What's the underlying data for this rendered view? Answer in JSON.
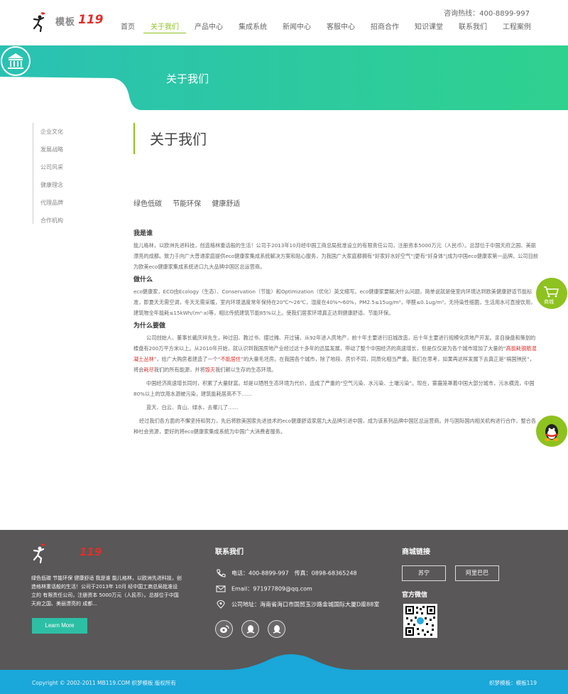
{
  "header": {
    "brand_text": "模板",
    "brand_num": "119",
    "hotline": "咨询热线：400-8899-997",
    "nav": [
      {
        "label": "首页",
        "active": false
      },
      {
        "label": "关于我们",
        "active": true
      },
      {
        "label": "产品中心",
        "active": false
      },
      {
        "label": "集成系统",
        "active": false
      },
      {
        "label": "新闻中心",
        "active": false
      },
      {
        "label": "客服中心",
        "active": false
      },
      {
        "label": "招商合作",
        "active": false
      },
      {
        "label": "知识课堂",
        "active": false
      },
      {
        "label": "联系我们",
        "active": false
      },
      {
        "label": "工程案例",
        "active": false
      }
    ]
  },
  "banner": {
    "title": "关于我们",
    "icon": "bank-icon"
  },
  "sidebar": {
    "items": [
      "企业文化",
      "发展战略",
      "公司风采",
      "健康理念",
      "代理品牌",
      "合作机构"
    ]
  },
  "main": {
    "title": "关于我们",
    "tags": [
      "绿色低碳",
      "节能环保",
      "健康舒适"
    ],
    "sections": {
      "who_title": "我是谁",
      "who_text": "能儿格林，以欧洲先进科技，创造格林重话般的生活！公司于2013年10月经中国工商总局批准设立的有限责任公司，注册资本5000万元（人民币）。总部位于中国天府之国、美丽漂亮的成都。致力于向广大普通家庭提供eco健康家集成系统解决方案和贴心服务，为我国广大家庭都拥有“好家好水好空气”|更有“好身体”|成为中国eco健康家第一品牌。公司目前为欧美eco健康家集成系统进口九大品牌中国区总运营商。",
      "what_title": "做什么",
      "what_text": "eco健康家，ECO由Ecology（生态）、Conservation（节能）和Optimization（优化）英文缩写。eco健康家要解决什么问题，简单说就是使室内环境达到欧美健康舒适节能标准，即夏天无需空调，冬天无需采暖，室内环境温度常年保持在20℃～26℃，湿度在40%～60%，PM2.5≤15ug/m³，甲醛≤0.1ug/m³，无持染性细菌，生活用水可直接饮用，建筑物全年能耗≤15kWh/(m²·a)等，相比传统建筑节能85%以上。使我们居家环境真正达到健康舒适、节能环保。",
      "why_title": "为什么要做",
      "why_p1_a": "公司创始人、董事长戴庆祥先生，种过田、教过书、摆过摊、开过铺，从92年进入房地产，前十年主要进行旧城改造，后十年主要进行规模化房地产开发。亲自操盘和策划的楼盘有200万平方米以上。从2010年开始，就认识到我国房地产业经过这十多年的迅猛发展，带动了整个中国经济的高速增长，但是仅仅是为各个城市增加了大量的“",
      "why_p1_red1": "高能耗钢筋混凝土丛林",
      "why_p1_b": "”，给广大购房者建造了一个“",
      "why_p1_red2": "不能居住",
      "why_p1_c": "”的大量毛坯房。在我国各个城市，除了地段、房价不同，同质化相当严重。我们在思考，如果再这样发展下去真正是“祸国殃民”，将会",
      "why_p1_red3": "耗尽",
      "why_p1_d": "我们的所有能源，并将",
      "why_p1_red4": "毁灭",
      "why_p1_e": "我们赖以生存的生态环境。",
      "why_p2": "中国经济高速增长同时，积累了大量财富。却是以牺牲生态环境为代价，造成了严重的“空气污染、水污染、土壤污染”。现在，雾霾笼罩着中国大部分城市，污水横流，中国80%以上的饮用水源被污染，建筑能耗居高不下……",
      "why_p3": "蓝天、白云、青山、绿水，去哪儿了……",
      "why_p4": "经过我们各方面的不懈坚持和努力，先后将欧美国家先进技术的eco健康舒适家居九大品牌引进中国，成为该系列品牌中国区总运营商。并与国际国内相关机构进行合作，整合各种社会资源，更好的将eco健康家集成系统为中国广大消费者服务。"
    }
  },
  "floats": {
    "mall_label": "商城",
    "qq_icon": "qq-penguin-icon"
  },
  "footer": {
    "brand_num": "119",
    "about": "绿色低碳 节能环保 健康舒适 我是谁 能儿格林，以欧洲先进科技，创造格林重话般的生活！公司于2013年 10月 经中国工商总局批准设立的 有限责任公司，注册资本 5000万元（人民币）。总部位于中国天府之国、美丽漂亮的 成都...",
    "learn_more": "Learn More",
    "contact_title": "联系我们",
    "phone": "电话：400-8899-997　传真：0898-68365248",
    "email": "Email：971977809@qq.com",
    "address": "公司地址：海南省海口市国贸玉沙路金城国际大厦D座88室",
    "mall_title": "商城链接",
    "mall_links": [
      "苏宁",
      "阿里巴巴"
    ],
    "wechat_title": "官方微信",
    "copyright": "Copyright © 2002-2011 MB119.COM 织梦模板 版权所有",
    "right_text": "织梦模板：模板119"
  },
  "colors": {
    "accent_green": "#8ec21f",
    "teal": "#2dbfa5",
    "footer_bg": "#595757",
    "bottom_bar": "#1aa7d9"
  }
}
